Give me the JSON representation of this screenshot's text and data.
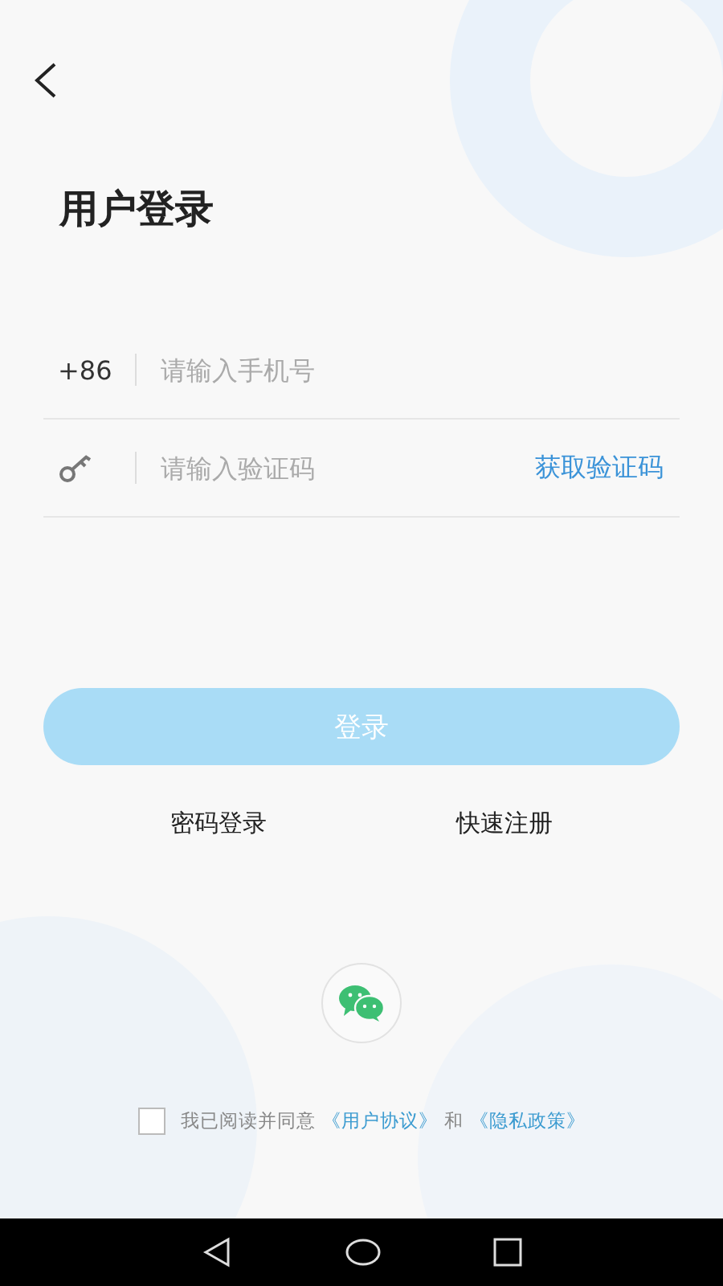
{
  "title": "用户登录",
  "phone": {
    "prefix": "+86",
    "placeholder": "请输入手机号"
  },
  "code": {
    "placeholder": "请输入验证码",
    "action": "获取验证码"
  },
  "login_button": {
    "label": "登录",
    "disabled": true
  },
  "links": [
    "密码登录",
    "快速注册"
  ],
  "agreement": {
    "checked": false,
    "text": "我已阅读并同意",
    "conjunction": "和",
    "links": [
      "《用户协议》",
      "《隐私政策》"
    ]
  }
}
